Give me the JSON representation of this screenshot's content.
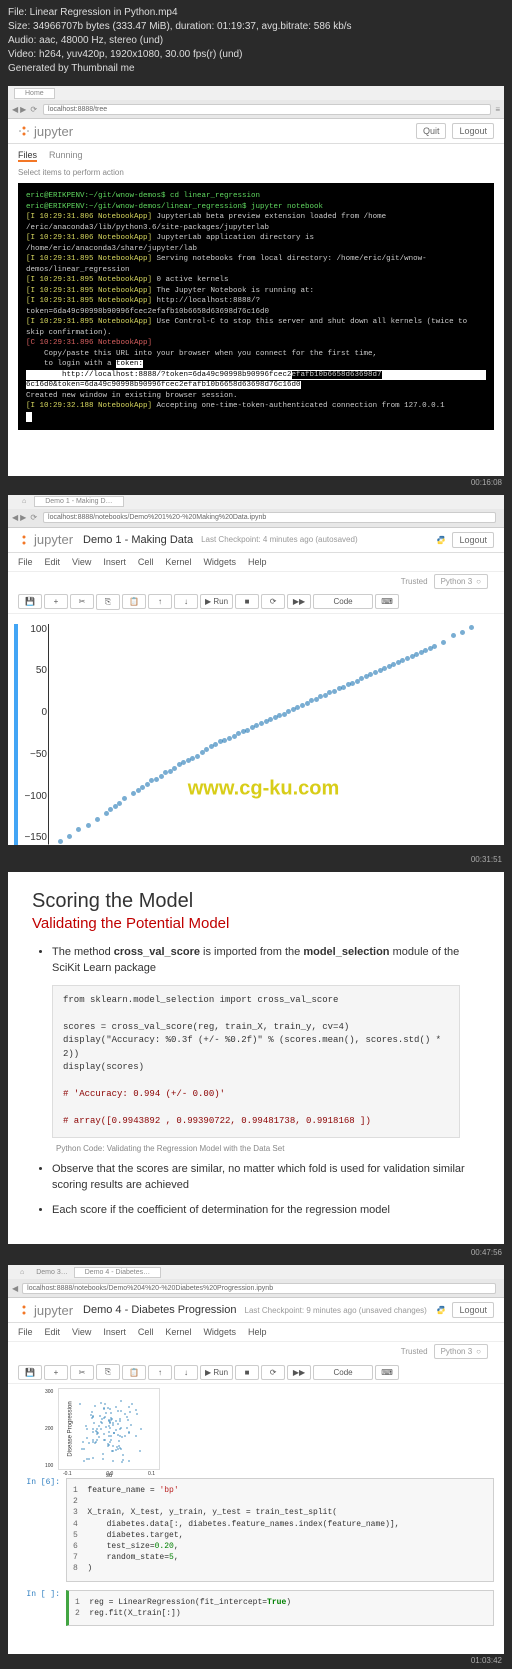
{
  "meta": {
    "file": "File: Linear Regression in Python.mp4",
    "size": "Size: 34966707b bytes (333.47 MiB), duration: 01:19:37, avg.bitrate: 586 kb/s",
    "audio": "Audio: aac, 48000 Hz, stereo (und)",
    "video": "Video: h264, yuv420p, 1920x1080, 30.00 fps(r) (und)",
    "generated": "Generated by Thumbnail me"
  },
  "panel1": {
    "url": "localhost:8888/tree",
    "title": "jupyter",
    "logout": "Logout",
    "tabs": {
      "files": "Files",
      "running": "Running"
    },
    "sidenote": "Select items to perform action",
    "terminal": {
      "l1": "eric@ERIKPENV:~/git/wnow-demos$ cd linear_regression",
      "l2": "eric@ERIKPENV:~/git/wnow-demos/linear_regression$ jupyter notebook",
      "l3": "[I 10:29:31.806 NotebookApp] JupyterLab beta preview extension loaded from /home/eric/anaconda3/lib/python3.6/site-packages/jupyterlab",
      "l4": "[I 10:29:31.806 NotebookApp] JupyterLab application directory is /home/eric/anaconda3/share/jupyter/lab",
      "l5": "[I 10:29:31.895 NotebookApp] Serving notebooks from local directory: /home/eric/git/wnow-demos/linear_regression",
      "l6": "[I 10:29:31.895 NotebookApp] 0 active kernels",
      "l7": "[I 10:29:31.895 NotebookApp] The Jupyter Notebook is running at:",
      "l8": "[I 10:29:31.895 NotebookApp] http://localhost:8888/?token=6da49c90998b90996fcec2efafb10b6658d63698d76c16d0",
      "l9": "[I 10:29:31.895 NotebookApp] Use Control-C to stop this server and shut down all kernels (twice to skip confirmation).",
      "l10": "[C 10:29:31.896 NotebookApp]",
      "l11": "    Copy/paste this URL into your browser when you connect for the first time,",
      "l12": "    to login with a token:",
      "l13": "        http://localhost:8888/?token=6da49c90998b90996fcec2efafb10b6658d63698d76c16d0&token=6da49c90998b90996fcec2efafb10b6658d63698d76c16d0",
      "l14": "[I 10:29:32.188 NotebookApp] Accepting one-time-token-authenticated connection from 127.0.0.1",
      "l15": "Created new window in existing browser session."
    },
    "ts": "00:16:08"
  },
  "panel2": {
    "url": "localhost:8888/notebooks/Demo%201%20-%20Making%20Data.ipynb",
    "title": "jupyter",
    "nb": "Demo 1 - Making Data",
    "checkpoint": "Last Checkpoint: 4 minutes ago  (autosaved)",
    "logout": "Logout",
    "trusted": "Trusted",
    "kernel": "Python 3",
    "menu": {
      "file": "File",
      "edit": "Edit",
      "view": "View",
      "insert": "Insert",
      "cell": "Cell",
      "kernel": "Kernel",
      "widgets": "Widgets",
      "help": "Help"
    },
    "toolbar": {
      "run": "▶ Run",
      "celltype": "Code"
    },
    "yaxis": [
      "100",
      "50",
      "0",
      "−50",
      "−100",
      "−150"
    ],
    "watermark": "www.cg-ku.com",
    "ts": "00:31:51"
  },
  "chart_data": {
    "type": "scatter",
    "title": "",
    "xlabel": "",
    "ylabel": "",
    "ylim": [
      -150,
      120
    ],
    "x": [
      -2.4,
      -2.3,
      -2.2,
      -2.1,
      -2.0,
      -1.9,
      -1.85,
      -1.8,
      -1.75,
      -1.7,
      -1.6,
      -1.55,
      -1.5,
      -1.45,
      -1.4,
      -1.35,
      -1.3,
      -1.25,
      -1.2,
      -1.15,
      -1.1,
      -1.05,
      -1.0,
      -0.95,
      -0.9,
      -0.85,
      -0.8,
      -0.75,
      -0.7,
      -0.65,
      -0.6,
      -0.55,
      -0.5,
      -0.45,
      -0.4,
      -0.35,
      -0.3,
      -0.25,
      -0.2,
      -0.15,
      -0.1,
      -0.05,
      0.0,
      0.05,
      0.1,
      0.15,
      0.2,
      0.25,
      0.3,
      0.35,
      0.4,
      0.45,
      0.5,
      0.55,
      0.6,
      0.65,
      0.7,
      0.75,
      0.8,
      0.85,
      0.9,
      0.95,
      1.0,
      1.05,
      1.1,
      1.15,
      1.2,
      1.25,
      1.3,
      1.35,
      1.4,
      1.45,
      1.5,
      1.55,
      1.6,
      1.65,
      1.7,
      1.8,
      1.9,
      2.0,
      2.1
    ],
    "y": [
      -145,
      -138,
      -130,
      -125,
      -118,
      -110,
      -105,
      -102,
      -98,
      -92,
      -85,
      -82,
      -78,
      -75,
      -70,
      -68,
      -65,
      -60,
      -58,
      -55,
      -50,
      -48,
      -45,
      -42,
      -40,
      -35,
      -32,
      -28,
      -25,
      -22,
      -20,
      -18,
      -15,
      -12,
      -10,
      -8,
      -5,
      -2,
      0,
      3,
      5,
      8,
      10,
      12,
      15,
      18,
      20,
      23,
      25,
      28,
      30,
      33,
      35,
      38,
      40,
      43,
      45,
      48,
      50,
      52,
      55,
      58,
      60,
      63,
      65,
      68,
      70,
      73,
      75,
      78,
      80,
      82,
      85,
      88,
      90,
      93,
      95,
      100,
      108,
      112,
      118
    ]
  },
  "panel3": {
    "h1": "Scoring the Model",
    "h2": "Validating the Potential Model",
    "b1_pre": "The method ",
    "b1_bold1": "cross_val_score",
    "b1_mid": " is imported from the ",
    "b1_bold2": "model_selection",
    "b1_post": " module of the SciKit Learn package",
    "code": {
      "l1": "from sklearn.model_selection import cross_val_score",
      "l2": "scores = cross_val_score(reg, train_X, train_y, cv=4)",
      "l3": "display(\"Accuracy: %0.3f (+/- %0.2f)\" % (scores.mean(), scores.std() * 2))",
      "l4": "display(scores)",
      "l5": "# 'Accuracy: 0.994 (+/- 0.00)'",
      "l6": "# array([0.9943892 , 0.99390722, 0.99481738, 0.9918168 ])"
    },
    "caption": "Python Code: Validating the Regression Model with the Data Set",
    "b2": "Observe that the scores are similar, no matter which fold is used for validation similar scoring results are achieved",
    "b3": "Each score if the coefficient of determination for the regression model",
    "ts": "00:47:56"
  },
  "panel4": {
    "url": "localhost:8888/notebooks/Demo%204%20-%20Diabetes%20Progression.ipynb",
    "title": "jupyter",
    "nb": "Demo 4 - Diabetes Progression",
    "checkpoint": "Last Checkpoint: 9 minutes ago  (unsaved changes)",
    "logout": "Logout",
    "trusted": "Trusted",
    "kernel": "Python 3",
    "menu": {
      "file": "File",
      "edit": "Edit",
      "view": "View",
      "insert": "Insert",
      "cell": "Cell",
      "kernel": "Kernel",
      "widgets": "Widgets",
      "help": "Help"
    },
    "toolbar": {
      "run": "▶ Run",
      "celltype": "Code"
    },
    "mini_chart": {
      "ylabel": "Disease Progression",
      "xlabel": "s6",
      "xticks": [
        "-0.1",
        "0.0",
        "0.1"
      ],
      "yticks": [
        "100",
        "200",
        "300"
      ]
    },
    "cell1": {
      "prompt": "In [6]:",
      "l1": "feature_name = 'bp'",
      "l2": "X_train, X_test, y_train, y_test = train_test_split(",
      "l3": "    diabetes.data[:, diabetes.feature_names.index(feature_name)],",
      "l4": "    diabetes.target,",
      "l5": "    test_size=0.20,",
      "l6": "    random_state=5",
      "l7": ")"
    },
    "cell2": {
      "prompt": "In [ ]:",
      "l1": "reg = LinearRegression(fit_intercept=True)",
      "l2": "reg.fit(X_train[:])"
    },
    "ts": "01:03:42"
  }
}
